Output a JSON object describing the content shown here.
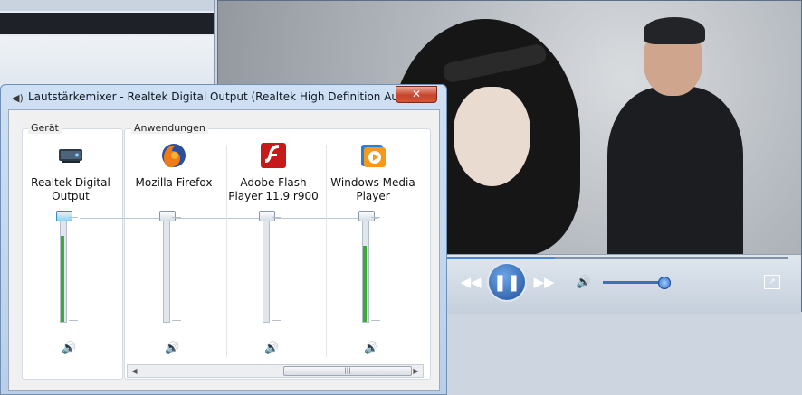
{
  "mixer": {
    "title": "Lautstärkemixer - Realtek Digital Output (Realtek High Definition Audio)",
    "close": "✕",
    "device_group_label": "Gerät",
    "apps_group_label": "Anwendungen",
    "channels": [
      {
        "label": "Realtek Digital Output",
        "level": 0.82,
        "icon": "speaker-device-icon"
      },
      {
        "label": "Mozilla Firefox",
        "level": 0.0,
        "icon": "firefox-icon"
      },
      {
        "label": "Adobe Flash Player 11.9 r900",
        "level": 0.0,
        "icon": "flash-player-icon"
      },
      {
        "label": "Windows Media Player",
        "level": 0.72,
        "icon": "media-player-icon"
      }
    ],
    "scroll_grip": "|||"
  },
  "player": {
    "prev": "◀◀",
    "play_pause": "❚❚",
    "next": "▶▶",
    "volume_icon": "🔊",
    "fullscreen": "↗",
    "volume_level": 0.87,
    "seek_position": 0.32
  }
}
